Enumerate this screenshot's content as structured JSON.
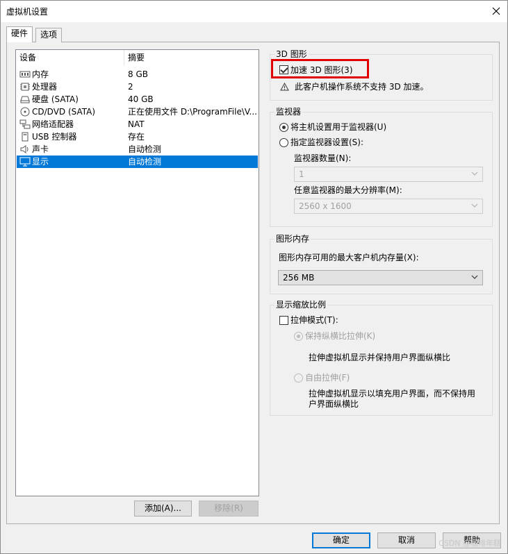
{
  "window": {
    "title": "虚拟机设置"
  },
  "tabs": [
    {
      "label": "硬件",
      "active": true
    },
    {
      "label": "选项",
      "active": false
    }
  ],
  "device_list": {
    "headers": {
      "device": "设备",
      "summary": "摘要"
    },
    "rows": [
      {
        "name": "内存",
        "summary": "8 GB",
        "icon": "memory-icon"
      },
      {
        "name": "处理器",
        "summary": "2",
        "icon": "processor-icon"
      },
      {
        "name": "硬盘 (SATA)",
        "summary": "40 GB",
        "icon": "hard-disk-icon"
      },
      {
        "name": "CD/DVD (SATA)",
        "summary": "正在使用文件 D:\\ProgramFile\\V...",
        "icon": "cd-dvd-icon"
      },
      {
        "name": "网络适配器",
        "summary": "NAT",
        "icon": "network-adapter-icon"
      },
      {
        "name": "USB 控制器",
        "summary": "存在",
        "icon": "usb-icon"
      },
      {
        "name": "声卡",
        "summary": "自动检测",
        "icon": "sound-card-icon"
      },
      {
        "name": "显示",
        "summary": "自动检测",
        "icon": "display-icon",
        "selected": true
      }
    ]
  },
  "list_buttons": {
    "add": "添加(A)...",
    "remove": "移除(R)"
  },
  "graphics_3d": {
    "legend": "3D 图形",
    "accelerate_label": "加速 3D 图形(3)",
    "accelerate_checked": true,
    "warning": "此客户机操作系统不支持 3D 加速。"
  },
  "monitor": {
    "legend": "监视器",
    "use_host_label": "将主机设置用于监视器(U)",
    "specify_label": "指定监视器设置(S):",
    "count_label": "监视器数量(N):",
    "count_value": "1",
    "max_res_label": "任意监视器的最大分辨率(M):",
    "max_res_value": "2560 x 1600",
    "selected": "use_host"
  },
  "graphics_memory": {
    "legend": "图形内存",
    "label": "图形内存可用的最大客户机内存量(X):",
    "value": "256 MB"
  },
  "display_scaling": {
    "legend": "显示缩放比例",
    "stretch_label": "拉伸模式(T):",
    "stretch_checked": false,
    "keep_aspect_label": "保持纵横比拉伸(K)",
    "keep_aspect_desc": "拉伸虚拟机显示并保持用户界面纵横比",
    "free_label": "自由拉伸(F)",
    "free_desc_line1": "拉伸虚拟机显示以填充用户界面，而不保持用",
    "free_desc_line2": "户界面纵横比"
  },
  "dialog_buttons": {
    "ok": "确定",
    "cancel": "取消",
    "help": "帮助"
  },
  "watermark": "CSDN @咖啡年糕",
  "colors": {
    "selection": "#0078d7",
    "highlight_box": "#e00000"
  }
}
